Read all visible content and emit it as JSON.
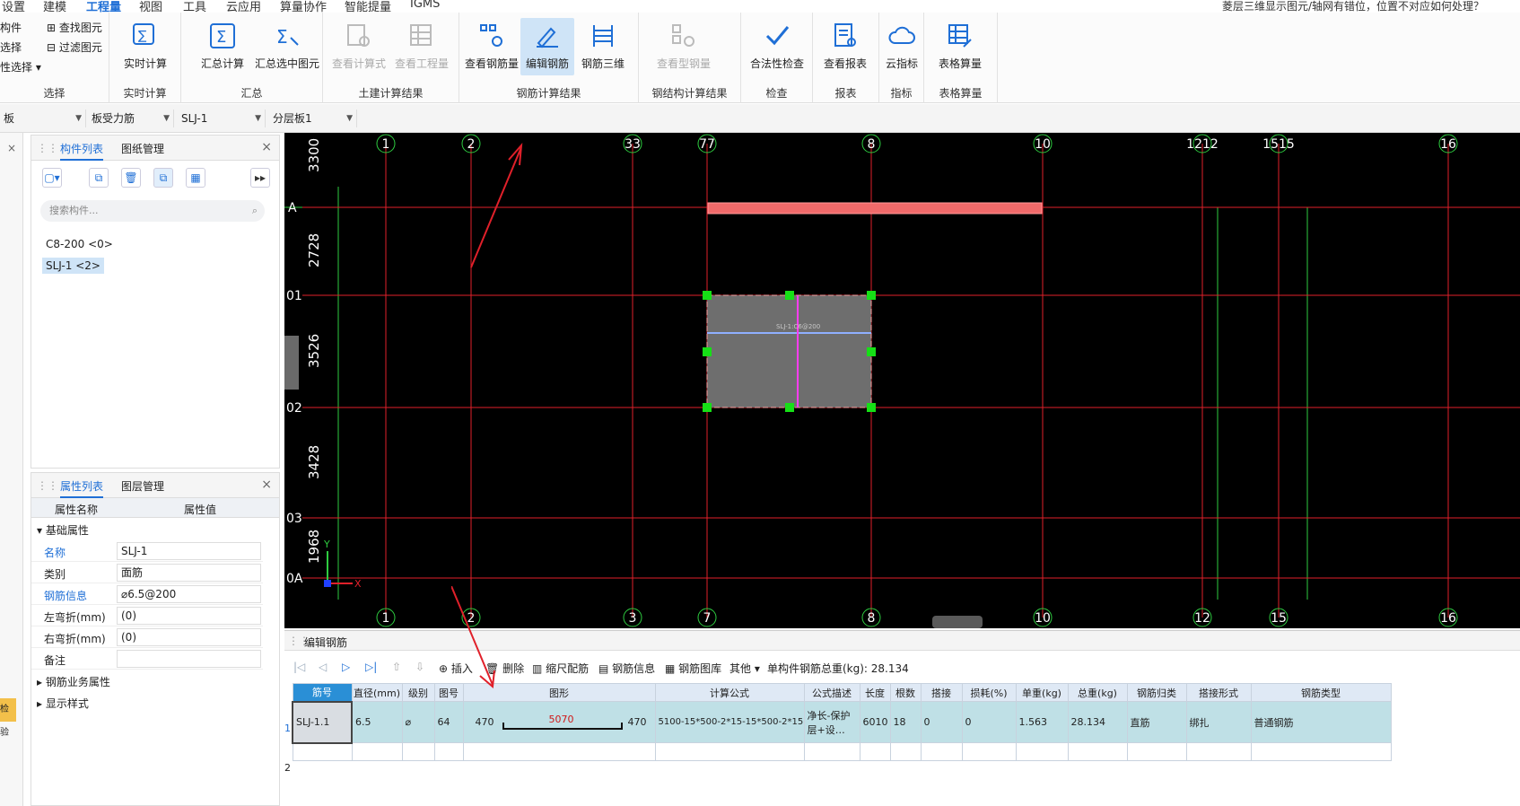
{
  "menu": {
    "items": [
      "设置",
      "建模",
      "工程量",
      "视图",
      "工具",
      "云应用",
      "算量协作",
      "智能提量",
      "IGMS"
    ],
    "active_index": 2,
    "help_text": "菱层三维显示图元/轴网有错位，位置不对应如何处理？"
  },
  "ribbon": {
    "select_group": {
      "title": "选择",
      "items": [
        "构件",
        "选择",
        "性选择 ▾"
      ],
      "find": "查找图元",
      "filter": "过滤图元"
    },
    "realtime_group": {
      "title": "实时计算",
      "btn": "实时计算"
    },
    "summary_group": {
      "title": "汇总",
      "btn1": "汇总计算",
      "btn2": "汇总选中图元"
    },
    "civil_group": {
      "title": "土建计算结果",
      "btn1": "查看计算式",
      "btn2": "查看工程量"
    },
    "rebar_group": {
      "title": "钢筋计算结果",
      "btn1": "查看钢筋量",
      "btn2": "编辑钢筋",
      "btn3": "钢筋三维"
    },
    "steel_group": {
      "title": "钢结构计算结果",
      "btn1": "查看型钢量"
    },
    "check_group": {
      "title": "检查",
      "btn1": "合法性检查"
    },
    "report_group": {
      "title": "报表",
      "btn1": "查看报表"
    },
    "index_group": {
      "title": "指标",
      "btn1": "云指标"
    },
    "table_group": {
      "title": "表格算量",
      "btn1": "表格算量"
    }
  },
  "toolbar2": {
    "c1": "板",
    "c2": "板受力筋",
    "c3": "SLJ-1",
    "c4": "分层板1"
  },
  "component_panel": {
    "tab1": "构件列表",
    "tab2": "图纸管理",
    "search_placeholder": "搜索构件...",
    "items": [
      "C8-200 <0>",
      "SLJ-1 <2>"
    ]
  },
  "property_panel": {
    "tab1": "属性列表",
    "tab2": "图层管理",
    "header_name": "属性名称",
    "header_value": "属性值",
    "section_basic": "基础属性",
    "rows": [
      {
        "k": "名称",
        "v": "SLJ-1"
      },
      {
        "k": "类别",
        "v": "面筋"
      },
      {
        "k": "钢筋信息",
        "v": "⌀6.5@200"
      },
      {
        "k": "左弯折(mm)",
        "v": "(0)"
      },
      {
        "k": "右弯折(mm)",
        "v": "(0)"
      },
      {
        "k": "备注",
        "v": ""
      }
    ],
    "section_business": "钢筋业务属性",
    "section_display": "显示样式",
    "left_badge": "检验"
  },
  "canvas": {
    "top_axis": [
      "1",
      "2",
      "33",
      "77",
      "8",
      "10",
      "1212",
      "1515",
      "16"
    ],
    "bottom_axis": [
      "1",
      "2",
      "3",
      "7",
      "8",
      "10",
      "12",
      "15",
      "16"
    ],
    "left_axis": [
      "A",
      "01",
      "02",
      "03",
      "0A"
    ],
    "dims": [
      "3300",
      "2728",
      "3526",
      "3428",
      "1968"
    ],
    "slab_label": "SLJ-1:C6@200",
    "axis_x": "X",
    "axis_y": "Y"
  },
  "rebar_editor": {
    "title": "编辑钢筋",
    "tools": [
      "插入",
      "删除",
      "缩尺配筋",
      "钢筋信息",
      "钢筋图库",
      "其他 ▾"
    ],
    "total_label": "单构件钢筋总重(kg): 28.134",
    "columns": [
      "筋号",
      "直径(mm)",
      "级别",
      "图号",
      "图形",
      "计算公式",
      "公式描述",
      "长度",
      "根数",
      "搭接",
      "损耗(%)",
      "单重(kg)",
      "总重(kg)",
      "钢筋归类",
      "搭接形式",
      "钢筋类型"
    ],
    "rows": [
      {
        "idx": "1",
        "no": "SLJ-1.1",
        "d": "6.5",
        "grade": "⌀",
        "fig": "64",
        "left": "470",
        "mid": "5070",
        "right": "470",
        "formula": "5100-15*500-2*15-15*500-2*15",
        "desc": "净长-保护层+设…",
        "len": "6010",
        "count": "18",
        "lap": "0",
        "loss": "0",
        "unit": "1.563",
        "total": "28.134",
        "cat": "直筋",
        "lapform": "绑扎",
        "type": "普通钢筋"
      }
    ],
    "empty_row_idx": "2"
  },
  "colors": {
    "accent": "#1f6fd6",
    "grid_red": "#e0202a",
    "grid_green": "#2ecc40",
    "canvas_bg": "#000000"
  }
}
